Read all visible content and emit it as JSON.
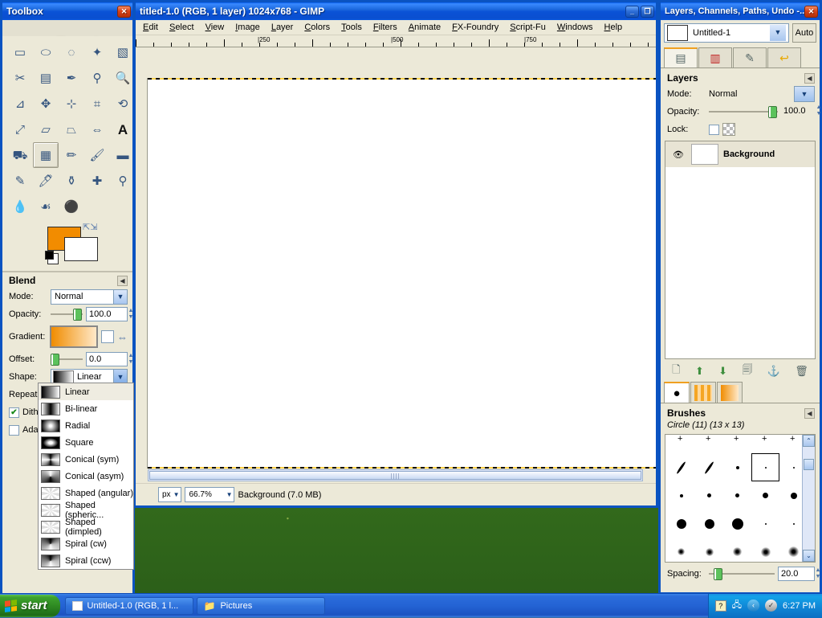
{
  "desktop": {
    "wallpaper_name": "bliss-grass"
  },
  "toolbox": {
    "title": "Toolbox",
    "close_label": "✕",
    "tools": [
      {
        "name": "rect-select-tool",
        "glyph": "▭"
      },
      {
        "name": "ellipse-select-tool",
        "glyph": "⬭"
      },
      {
        "name": "free-select-tool",
        "glyph": "◌"
      },
      {
        "name": "fuzzy-select-tool",
        "glyph": "✦"
      },
      {
        "name": "select-by-color-tool",
        "glyph": "▧"
      },
      {
        "name": "scissors-select-tool",
        "glyph": "✂"
      },
      {
        "name": "foreground-select-tool",
        "glyph": "▤"
      },
      {
        "name": "paths-tool",
        "glyph": "✒"
      },
      {
        "name": "color-picker-tool",
        "glyph": "⚲"
      },
      {
        "name": "zoom-tool",
        "glyph": "🔍"
      },
      {
        "name": "measure-tool",
        "glyph": "⊿"
      },
      {
        "name": "move-tool",
        "glyph": "✥"
      },
      {
        "name": "align-tool",
        "glyph": "⊹"
      },
      {
        "name": "crop-tool",
        "glyph": "⌗"
      },
      {
        "name": "rotate-tool",
        "glyph": "⟲"
      },
      {
        "name": "scale-tool",
        "glyph": "⤢"
      },
      {
        "name": "shear-tool",
        "glyph": "▱"
      },
      {
        "name": "perspective-tool",
        "glyph": "⏢"
      },
      {
        "name": "flip-tool",
        "glyph": "⇔"
      },
      {
        "name": "text-tool",
        "glyph": "A"
      },
      {
        "name": "bucket-fill-tool",
        "glyph": "⛟"
      },
      {
        "name": "blend-tool",
        "glyph": "▦"
      },
      {
        "name": "pencil-tool",
        "glyph": "✏"
      },
      {
        "name": "paintbrush-tool",
        "glyph": "🖌"
      },
      {
        "name": "eraser-tool",
        "glyph": "▬"
      },
      {
        "name": "airbrush-tool",
        "glyph": "✎"
      },
      {
        "name": "ink-tool",
        "glyph": "🖊"
      },
      {
        "name": "clone-tool",
        "glyph": "⚱"
      },
      {
        "name": "healing-tool",
        "glyph": "✚"
      },
      {
        "name": "perspective-clone-tool",
        "glyph": "⚲"
      },
      {
        "name": "blur-sharpen-tool",
        "glyph": "💧"
      },
      {
        "name": "smudge-tool",
        "glyph": "☙"
      },
      {
        "name": "dodge-burn-tool",
        "glyph": "⚫"
      }
    ],
    "selected_tool_index": 21,
    "colors": {
      "foreground": "#f28c00",
      "background": "#ffffff"
    }
  },
  "tool_options": {
    "title": "Blend",
    "collapse_glyph": "◀",
    "mode": {
      "label": "Mode:",
      "value": "Normal"
    },
    "opacity": {
      "label": "Opacity:",
      "value": "100.0"
    },
    "gradient": {
      "label": "Gradient:"
    },
    "offset": {
      "label": "Offset:",
      "value": "0.0"
    },
    "shape": {
      "label": "Shape:",
      "value": "Linear"
    },
    "repeat": {
      "label": "Repeat:"
    },
    "dither": {
      "label": "Dithe",
      "checked": true,
      "check_glyph": "✔"
    },
    "adaptive": {
      "label": "Adap",
      "checked": false
    },
    "shape_options": [
      {
        "label": "Linear",
        "swatch": "linear"
      },
      {
        "label": "Bi-linear",
        "swatch": "bilinear"
      },
      {
        "label": "Radial",
        "swatch": "radial"
      },
      {
        "label": "Square",
        "swatch": "square"
      },
      {
        "label": "Conical (sym)",
        "swatch": "conical-sym"
      },
      {
        "label": "Conical (asym)",
        "swatch": "conical-asym"
      },
      {
        "label": "Shaped (angular)",
        "swatch": "shaped"
      },
      {
        "label": "Shaped (spheric...",
        "swatch": "shaped"
      },
      {
        "label": "Shaped (dimpled)",
        "swatch": "shaped"
      },
      {
        "label": "Spiral (cw)",
        "swatch": "spiral"
      },
      {
        "label": "Spiral (ccw)",
        "swatch": "spiral"
      }
    ],
    "selected_shape_index": 0
  },
  "image_window": {
    "title": "titled-1.0 (RGB, 1 layer) 1024x768 - GIMP",
    "minimize_glyph": "_",
    "maximize_glyph": "❐",
    "menus": [
      "Edit",
      "Select",
      "View",
      "Image",
      "Layer",
      "Colors",
      "Tools",
      "Filters",
      "Animate",
      "FX-Foundry",
      "Script-Fu",
      "Windows",
      "Help"
    ],
    "ruler_labels": [
      "250",
      "500",
      "750"
    ],
    "statusbar": {
      "unit": "px",
      "zoom": "66.7%",
      "text": "Background (7.0 MB)"
    }
  },
  "layers_dock": {
    "title": "Layers, Channels, Paths, Undo -...",
    "close_label": "✕",
    "image_name": "Untitled-1",
    "auto_label": "Auto",
    "tabs": [
      {
        "name": "layers-tab",
        "glyph": "▤"
      },
      {
        "name": "channels-tab",
        "glyph": "▥"
      },
      {
        "name": "paths-tab",
        "glyph": "✎"
      },
      {
        "name": "undo-tab",
        "glyph": "↩"
      }
    ],
    "active_tab_index": 0,
    "panel_title": "Layers",
    "collapse_glyph": "◀",
    "mode": {
      "label": "Mode:",
      "value": "Normal"
    },
    "opacity": {
      "label": "Opacity:",
      "value": "100.0"
    },
    "lock": {
      "label": "Lock:"
    },
    "layers": [
      {
        "name": "Background",
        "visible": true,
        "eye_glyph": "👁"
      }
    ],
    "buttons": [
      {
        "name": "new-layer-button",
        "glyph": "🗋"
      },
      {
        "name": "raise-layer-button",
        "glyph": "⬆"
      },
      {
        "name": "lower-layer-button",
        "glyph": "⬇"
      },
      {
        "name": "duplicate-layer-button",
        "glyph": "🗐"
      },
      {
        "name": "anchor-layer-button",
        "glyph": "⚓"
      },
      {
        "name": "delete-layer-button",
        "glyph": "🗑"
      }
    ]
  },
  "brushes_dock": {
    "tabs": [
      {
        "name": "brushes-tab",
        "glyph": "●"
      },
      {
        "name": "patterns-tab",
        "glyph": "▥"
      },
      {
        "name": "gradients-tab",
        "glyph": "▨"
      }
    ],
    "active_tab_index": 0,
    "panel_title": "Brushes",
    "collapse_glyph": "◀",
    "current_brush": "Circle (11) (13 x 13)",
    "spacing": {
      "label": "Spacing:",
      "value": "20.0"
    },
    "selected_brush_index": 8,
    "scroll_up_glyph": "⌃",
    "scroll_down_glyph": "⌄"
  },
  "taskbar": {
    "start_label": "start",
    "buttons": [
      {
        "name": "taskbar-gimp-button",
        "label": "Untitled-1.0 (RGB, 1 l...",
        "icon": "window-icon"
      },
      {
        "name": "taskbar-pictures-button",
        "label": "Pictures",
        "icon": "folder-icon"
      }
    ],
    "tray": {
      "icons": [
        {
          "name": "help-tray-icon",
          "glyph": "?"
        },
        {
          "name": "network-tray-icon",
          "glyph": "🖧"
        },
        {
          "name": "show-hidden-icons-button",
          "glyph": "‹"
        },
        {
          "name": "security-tray-icon",
          "glyph": "✓"
        }
      ],
      "clock": "6:27 PM"
    }
  }
}
